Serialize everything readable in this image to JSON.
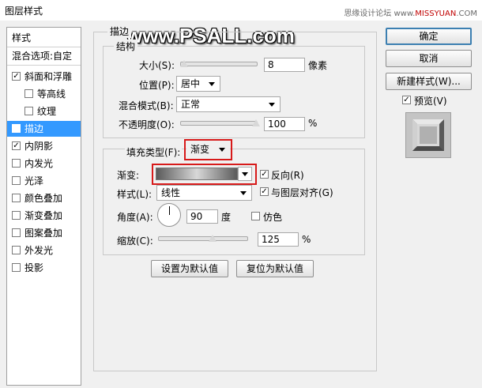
{
  "window": {
    "title": "图层样式"
  },
  "watermark": {
    "site_name": "思缘设计论坛",
    "site_url_prefix": "www.",
    "site_url_brand": "MISSYUAN",
    "site_url_suffix": ".COM",
    "overlay": "www.PSALL.com"
  },
  "left_panel": {
    "header": "样式",
    "blend_options": "混合选项:自定",
    "items": [
      {
        "label": "斜面和浮雕",
        "checked": true,
        "indent": false,
        "selected": false
      },
      {
        "label": "等高线",
        "checked": false,
        "indent": true,
        "selected": false
      },
      {
        "label": "纹理",
        "checked": false,
        "indent": true,
        "selected": false
      },
      {
        "label": "描边",
        "checked": true,
        "indent": false,
        "selected": true
      },
      {
        "label": "内阴影",
        "checked": true,
        "indent": false,
        "selected": false
      },
      {
        "label": "内发光",
        "checked": false,
        "indent": false,
        "selected": false
      },
      {
        "label": "光泽",
        "checked": false,
        "indent": false,
        "selected": false
      },
      {
        "label": "颜色叠加",
        "checked": false,
        "indent": false,
        "selected": false
      },
      {
        "label": "渐变叠加",
        "checked": false,
        "indent": false,
        "selected": false
      },
      {
        "label": "图案叠加",
        "checked": false,
        "indent": false,
        "selected": false
      },
      {
        "label": "外发光",
        "checked": false,
        "indent": false,
        "selected": false
      },
      {
        "label": "投影",
        "checked": false,
        "indent": false,
        "selected": false
      }
    ]
  },
  "stroke": {
    "section_title": "描边",
    "structure_title": "结构",
    "size": {
      "label": "大小(S):",
      "value": "8",
      "unit": "像素",
      "fraction": 0.05
    },
    "position": {
      "label": "位置(P):",
      "value": "居中"
    },
    "blend_mode": {
      "label": "混合模式(B):",
      "value": "正常"
    },
    "opacity": {
      "label": "不透明度(O):",
      "value": "100",
      "unit": "%",
      "fraction": 1.0
    },
    "fill_type": {
      "label": "填充类型(F):",
      "value": "渐变"
    },
    "gradient": {
      "label": "渐变:"
    },
    "reverse": {
      "label": "反向(R)",
      "checked": true
    },
    "style": {
      "label": "样式(L):",
      "value": "线性"
    },
    "align_layer": {
      "label": "与图层对齐(G)",
      "checked": true
    },
    "angle": {
      "label": "角度(A):",
      "value": "90",
      "unit": "度"
    },
    "dither": {
      "label": "仿色",
      "checked": false
    },
    "scale": {
      "label": "缩放(C):",
      "value": "125",
      "unit": "%",
      "fraction": 0.62
    },
    "set_default": "设置为默认值",
    "reset_default": "复位为默认值"
  },
  "right_panel": {
    "ok": "确定",
    "cancel": "取消",
    "new_style": "新建样式(W)...",
    "preview_label": "预览(V)",
    "preview_checked": true
  }
}
